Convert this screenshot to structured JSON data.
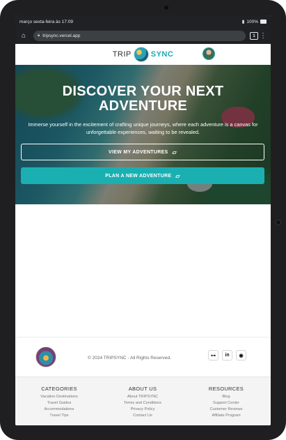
{
  "status_bar": {
    "time": "março sexta-feira às 17:09",
    "signal": "▮",
    "battery": "100%"
  },
  "browser": {
    "url": "tripsync.vercel.app",
    "tabs_count": "1"
  },
  "site": {
    "logo_trip": "TRIP",
    "logo_sync": "SYNC"
  },
  "hero": {
    "title_line1": "DISCOVER YOUR NEXT",
    "title_line2": "ADVENTURE",
    "subtitle": "Immerse yourself in the excitement of crafting unique journeys, where each adventure is a canvas for unforgettable experiences, waiting to be revealed.",
    "button_view": "VIEW MY ADVENTURES",
    "button_plan": "PLAN A NEW ADVENTURE"
  },
  "footer": {
    "copyright": "© 2024 TRIPSYNC - All Rights Reserved.",
    "categories": {
      "title": "CATEGORIES",
      "links": [
        "Vacation Destinations",
        "Travel Guides",
        "Accommodations",
        "Travel Tips"
      ]
    },
    "about": {
      "title": "ABOUT US",
      "links": [
        "About TRIPSYNC",
        "Terms and Conditions",
        "Privacy Policy",
        "Contact Us"
      ]
    },
    "resources": {
      "title": "RESOURCES",
      "links": [
        "Blog",
        "Support Center",
        "Customer Reviews",
        "Affiliate Program"
      ]
    }
  },
  "colors": {
    "accent": "#1ab0b2",
    "chrome": "#202124",
    "footer_bg": "#f4f4f5"
  },
  "icons": [
    "home-icon",
    "lock-icon",
    "tabs-icon",
    "menu-icon",
    "globe-logo-icon",
    "user-avatar",
    "map-icon",
    "sitemap-icon",
    "linkedin-icon",
    "github-icon"
  ]
}
